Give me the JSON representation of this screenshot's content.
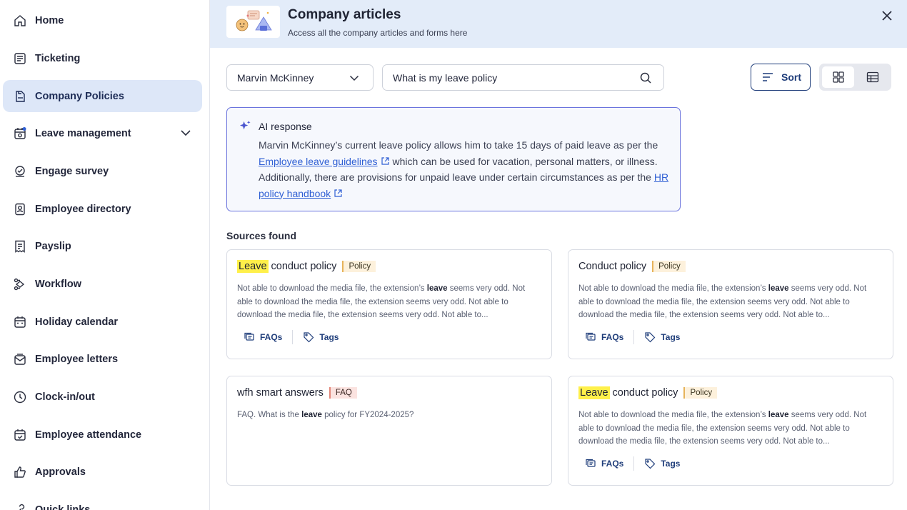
{
  "sidebar": {
    "items": [
      {
        "label": "Home",
        "icon": "home-icon"
      },
      {
        "label": "Ticketing",
        "icon": "ticket-icon"
      },
      {
        "label": "Company Policies",
        "icon": "policy-icon",
        "active": true
      },
      {
        "label": "Leave management",
        "icon": "leave-icon"
      },
      {
        "label": "Engage survey",
        "icon": "survey-icon"
      },
      {
        "label": "Employee directory",
        "icon": "directory-icon"
      },
      {
        "label": "Payslip",
        "icon": "payslip-icon"
      },
      {
        "label": "Workflow",
        "icon": "workflow-icon"
      },
      {
        "label": "Holiday calendar",
        "icon": "calendar-icon"
      },
      {
        "label": "Employee letters",
        "icon": "letters-icon"
      },
      {
        "label": "Clock-in/out",
        "icon": "clock-icon"
      },
      {
        "label": "Employee attendance",
        "icon": "attendance-icon"
      },
      {
        "label": "Approvals",
        "icon": "thumbs-up-icon"
      },
      {
        "label": "Quick links",
        "icon": "link-icon"
      }
    ]
  },
  "header": {
    "title": "Company articles",
    "subtitle": "Access all the company articles and forms here"
  },
  "filters": {
    "employee_selected": "Marvin McKinney",
    "search_value": "What is my leave policy"
  },
  "toolbar": {
    "sort_label": "Sort"
  },
  "ai": {
    "title": "AI response",
    "text_1": "Marvin McKinney’s current leave policy allows him to take  15 days of paid leave as per the ",
    "link_1": "Employee leave guidelines",
    "text_2": " which can be used for vacation, personal matters, or illness. Additionally, there are provisions for unpaid leave under certain circumstances as per the ",
    "link_2": "HR policy handbook"
  },
  "sources": {
    "title": "Sources found",
    "cards": [
      {
        "title_highlight": "Leave",
        "title_rest": " conduct policy",
        "tag": "Policy",
        "desc_1": "Not able to download the media file, the extension’s ",
        "desc_bold": "leave",
        "desc_2": " seems very odd. Not able to download the media file, the extension seems very odd. Not able to download the media file, the extension seems very odd. Not able to...",
        "faqs": "FAQs",
        "tags": "Tags"
      },
      {
        "title_highlight": "",
        "title_rest": "Conduct policy",
        "tag": "Policy",
        "desc_1": "Not able to download the media file, the extension’s ",
        "desc_bold": "leave",
        "desc_2": " seems very odd. Not able to download the media file, the extension seems very odd. Not able to download the media file, the extension seems very odd. Not able to...",
        "faqs": "FAQs",
        "tags": "Tags"
      },
      {
        "title_highlight": "",
        "title_rest": "wfh smart answers",
        "tag": "FAQ",
        "desc_1": "FAQ. What is the ",
        "desc_bold": "leave",
        "desc_2": " policy for FY2024-2025?"
      },
      {
        "title_highlight": "Leave",
        "title_rest": " conduct policy",
        "tag": "Policy",
        "desc_1": "Not able to download the media file, the extension’s ",
        "desc_bold": "leave",
        "desc_2": " seems very odd. Not able to download the media file, the extension seems very odd. Not able to download the media file, the extension seems very odd. Not able to...",
        "faqs": "FAQs",
        "tags": "Tags"
      }
    ]
  },
  "colors": {
    "accent": "#1f3d7a",
    "active_nav_bg": "#dde7f8",
    "header_bg": "#e3ecf9",
    "ai_border": "#6a73dd",
    "highlight": "#fff04a",
    "link": "#2f5fd4"
  }
}
